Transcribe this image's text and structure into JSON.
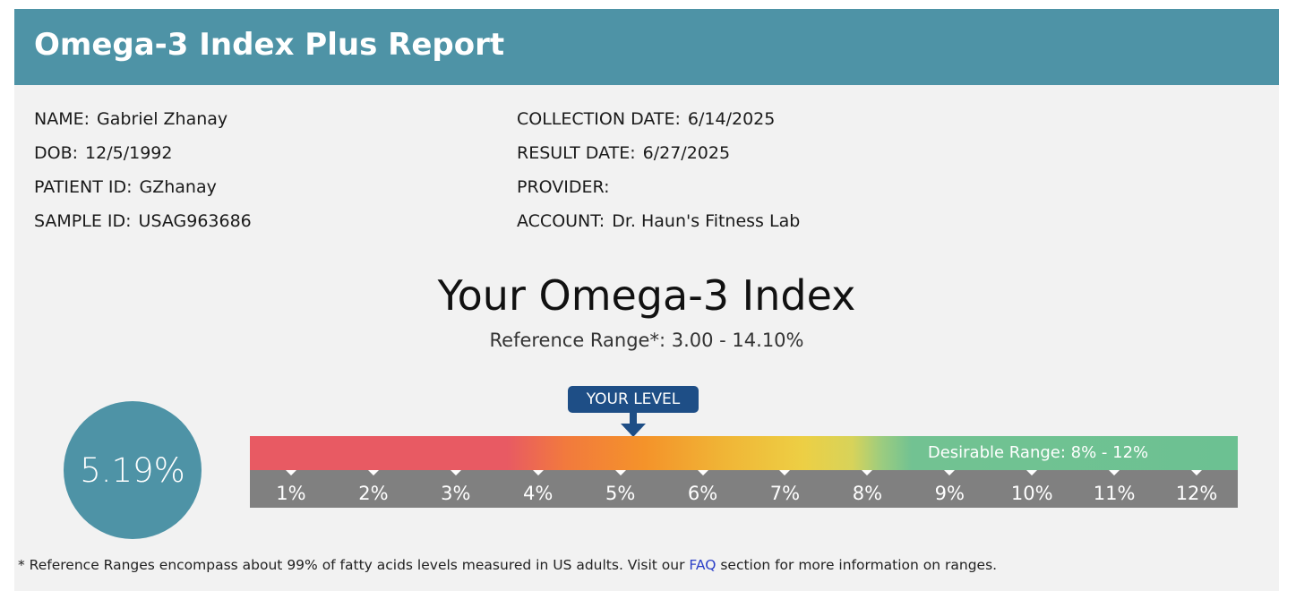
{
  "report": {
    "title": "Omega-3 Index Plus Report",
    "patient": [
      {
        "label": "NAME:",
        "value": "Gabriel Zhanay"
      },
      {
        "label": "DOB:",
        "value": "12/5/1992"
      },
      {
        "label": "PATIENT ID:",
        "value": "GZhanay"
      },
      {
        "label": "SAMPLE ID:",
        "value": "USAG963686"
      }
    ],
    "details": [
      {
        "label": "COLLECTION DATE:",
        "value": "6/14/2025"
      },
      {
        "label": "RESULT DATE:",
        "value": "6/27/2025"
      },
      {
        "label": "PROVIDER:",
        "value": ""
      },
      {
        "label": "ACCOUNT:",
        "value": "Dr. Haun's Fitness Lab"
      }
    ]
  },
  "index": {
    "heading": "Your Omega-3 Index",
    "reference_range": "Reference Range*:  3.00 - 14.10%",
    "value_text": "5.19%",
    "value": 5.19,
    "your_level_label": "YOUR LEVEL",
    "desirable_label": "Desirable Range: 8% - 12%",
    "scale_min": 0.5,
    "scale_max": 12.5,
    "ticks": [
      {
        "value": 1,
        "label": "1%"
      },
      {
        "value": 2,
        "label": "2%"
      },
      {
        "value": 3,
        "label": "3%"
      },
      {
        "value": 4,
        "label": "4%"
      },
      {
        "value": 5,
        "label": "5%"
      },
      {
        "value": 6,
        "label": "6%"
      },
      {
        "value": 7,
        "label": "7%"
      },
      {
        "value": 8,
        "label": "8%"
      },
      {
        "value": 9,
        "label": "9%"
      },
      {
        "value": 10,
        "label": "10%"
      },
      {
        "value": 11,
        "label": "11%"
      },
      {
        "value": 12,
        "label": "12%"
      }
    ]
  },
  "footnote": {
    "before": "* Reference Ranges encompass about 99% of fatty acids levels measured in US adults. Visit our ",
    "link": "FAQ",
    "after": " section for more information on ranges."
  },
  "colors": {
    "header": "#4e93a6",
    "level_badge": "#1e4e86",
    "low": "#e85a63",
    "mid": "#f4932a",
    "high": "#edcf44",
    "desirable": "#6cc192",
    "scale_bg": "#808080"
  }
}
